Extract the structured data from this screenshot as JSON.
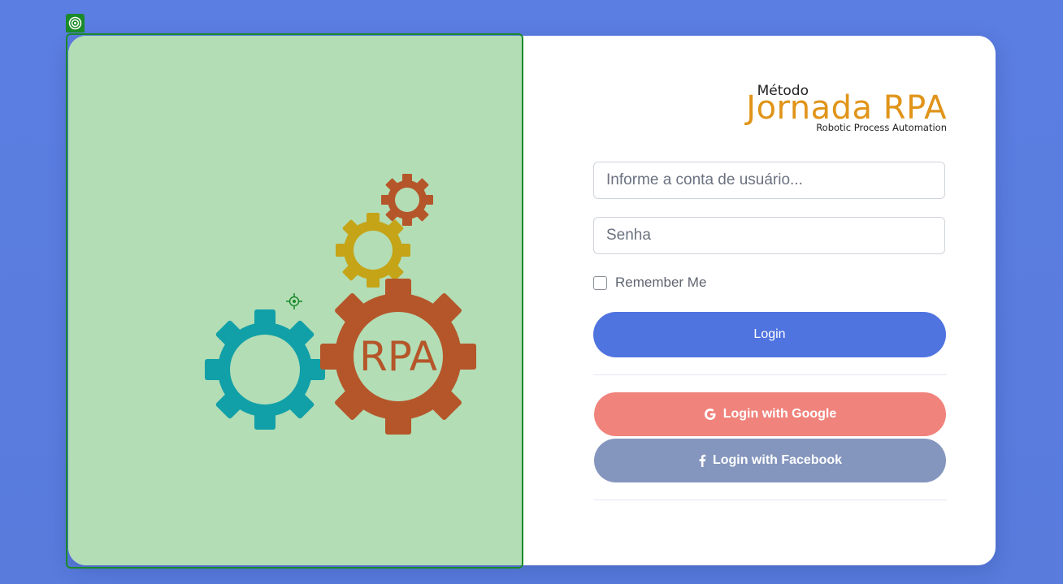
{
  "logo": {
    "top_text": "Método",
    "main_text": "Jornada RPA",
    "sub_text": "Robotic Process Automation"
  },
  "illustration": {
    "gear_label": "RPA"
  },
  "form": {
    "username_placeholder": "Informe a conta de usuário...",
    "password_placeholder": "Senha",
    "remember_label": "Remember Me",
    "login_label": "Login",
    "google_label": "Login with Google",
    "facebook_label": "Login with Facebook"
  },
  "colors": {
    "background": "#5a7fe0",
    "left_pane": "#b3ddb5",
    "login_button": "#4f73df",
    "google_button": "#f0837c",
    "facebook_button": "#8496be",
    "logo_accent": "#e09419",
    "selection_outline": "#1a8a2a"
  }
}
